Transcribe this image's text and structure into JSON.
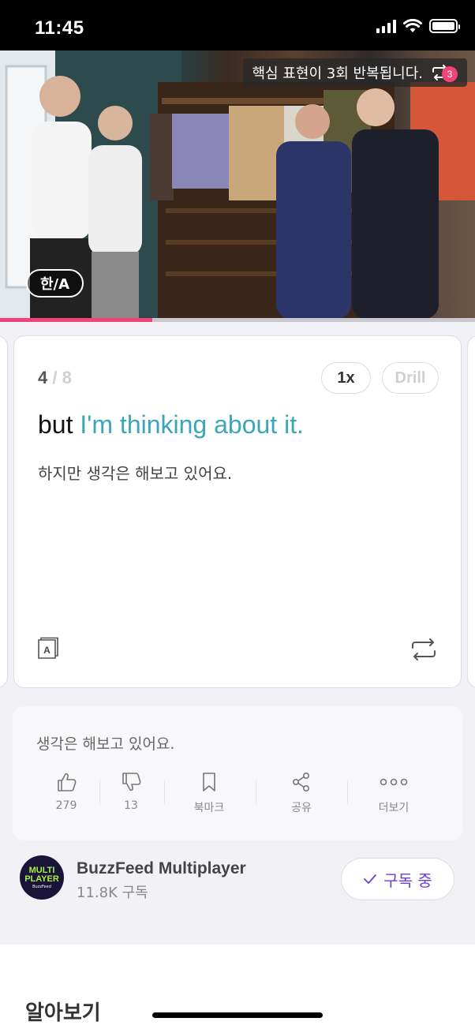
{
  "status_bar": {
    "time": "11:45"
  },
  "video": {
    "repeat_notice": "핵심 표현이 3회 반복됩니다.",
    "repeat_count": "3",
    "language_toggle": "한/A",
    "progress": 0.32
  },
  "card": {
    "current": "4",
    "total": "/ 8",
    "speed": "1x",
    "drill": "Drill",
    "sentence_prefix": "but ",
    "sentence_highlight": "I'm thinking about it.",
    "translation": "하지만 생각은 해보고 있어요."
  },
  "info": {
    "caption": "생각은 해보고 있어요.",
    "actions": [
      {
        "icon": "thumbs-up-icon",
        "label": "279"
      },
      {
        "icon": "thumbs-down-icon",
        "label": "13"
      },
      {
        "icon": "bookmark-icon",
        "label": "북마크"
      },
      {
        "icon": "share-icon",
        "label": "공유"
      },
      {
        "icon": "more-icon",
        "label": "더보기"
      }
    ]
  },
  "channel": {
    "logo_line1": "MULTI",
    "logo_line2": "PLAYER",
    "logo_line3": "BuzzFeed",
    "name": "BuzzFeed Multiplayer",
    "subscribers": "11.8K 구독",
    "subscribe_label": "구독 중"
  },
  "section": {
    "title": "알아보기"
  },
  "colors": {
    "accent_pink": "#f0437a",
    "highlight_teal": "#3aa6ba",
    "subscribe_purple": "#6b3fd8"
  }
}
